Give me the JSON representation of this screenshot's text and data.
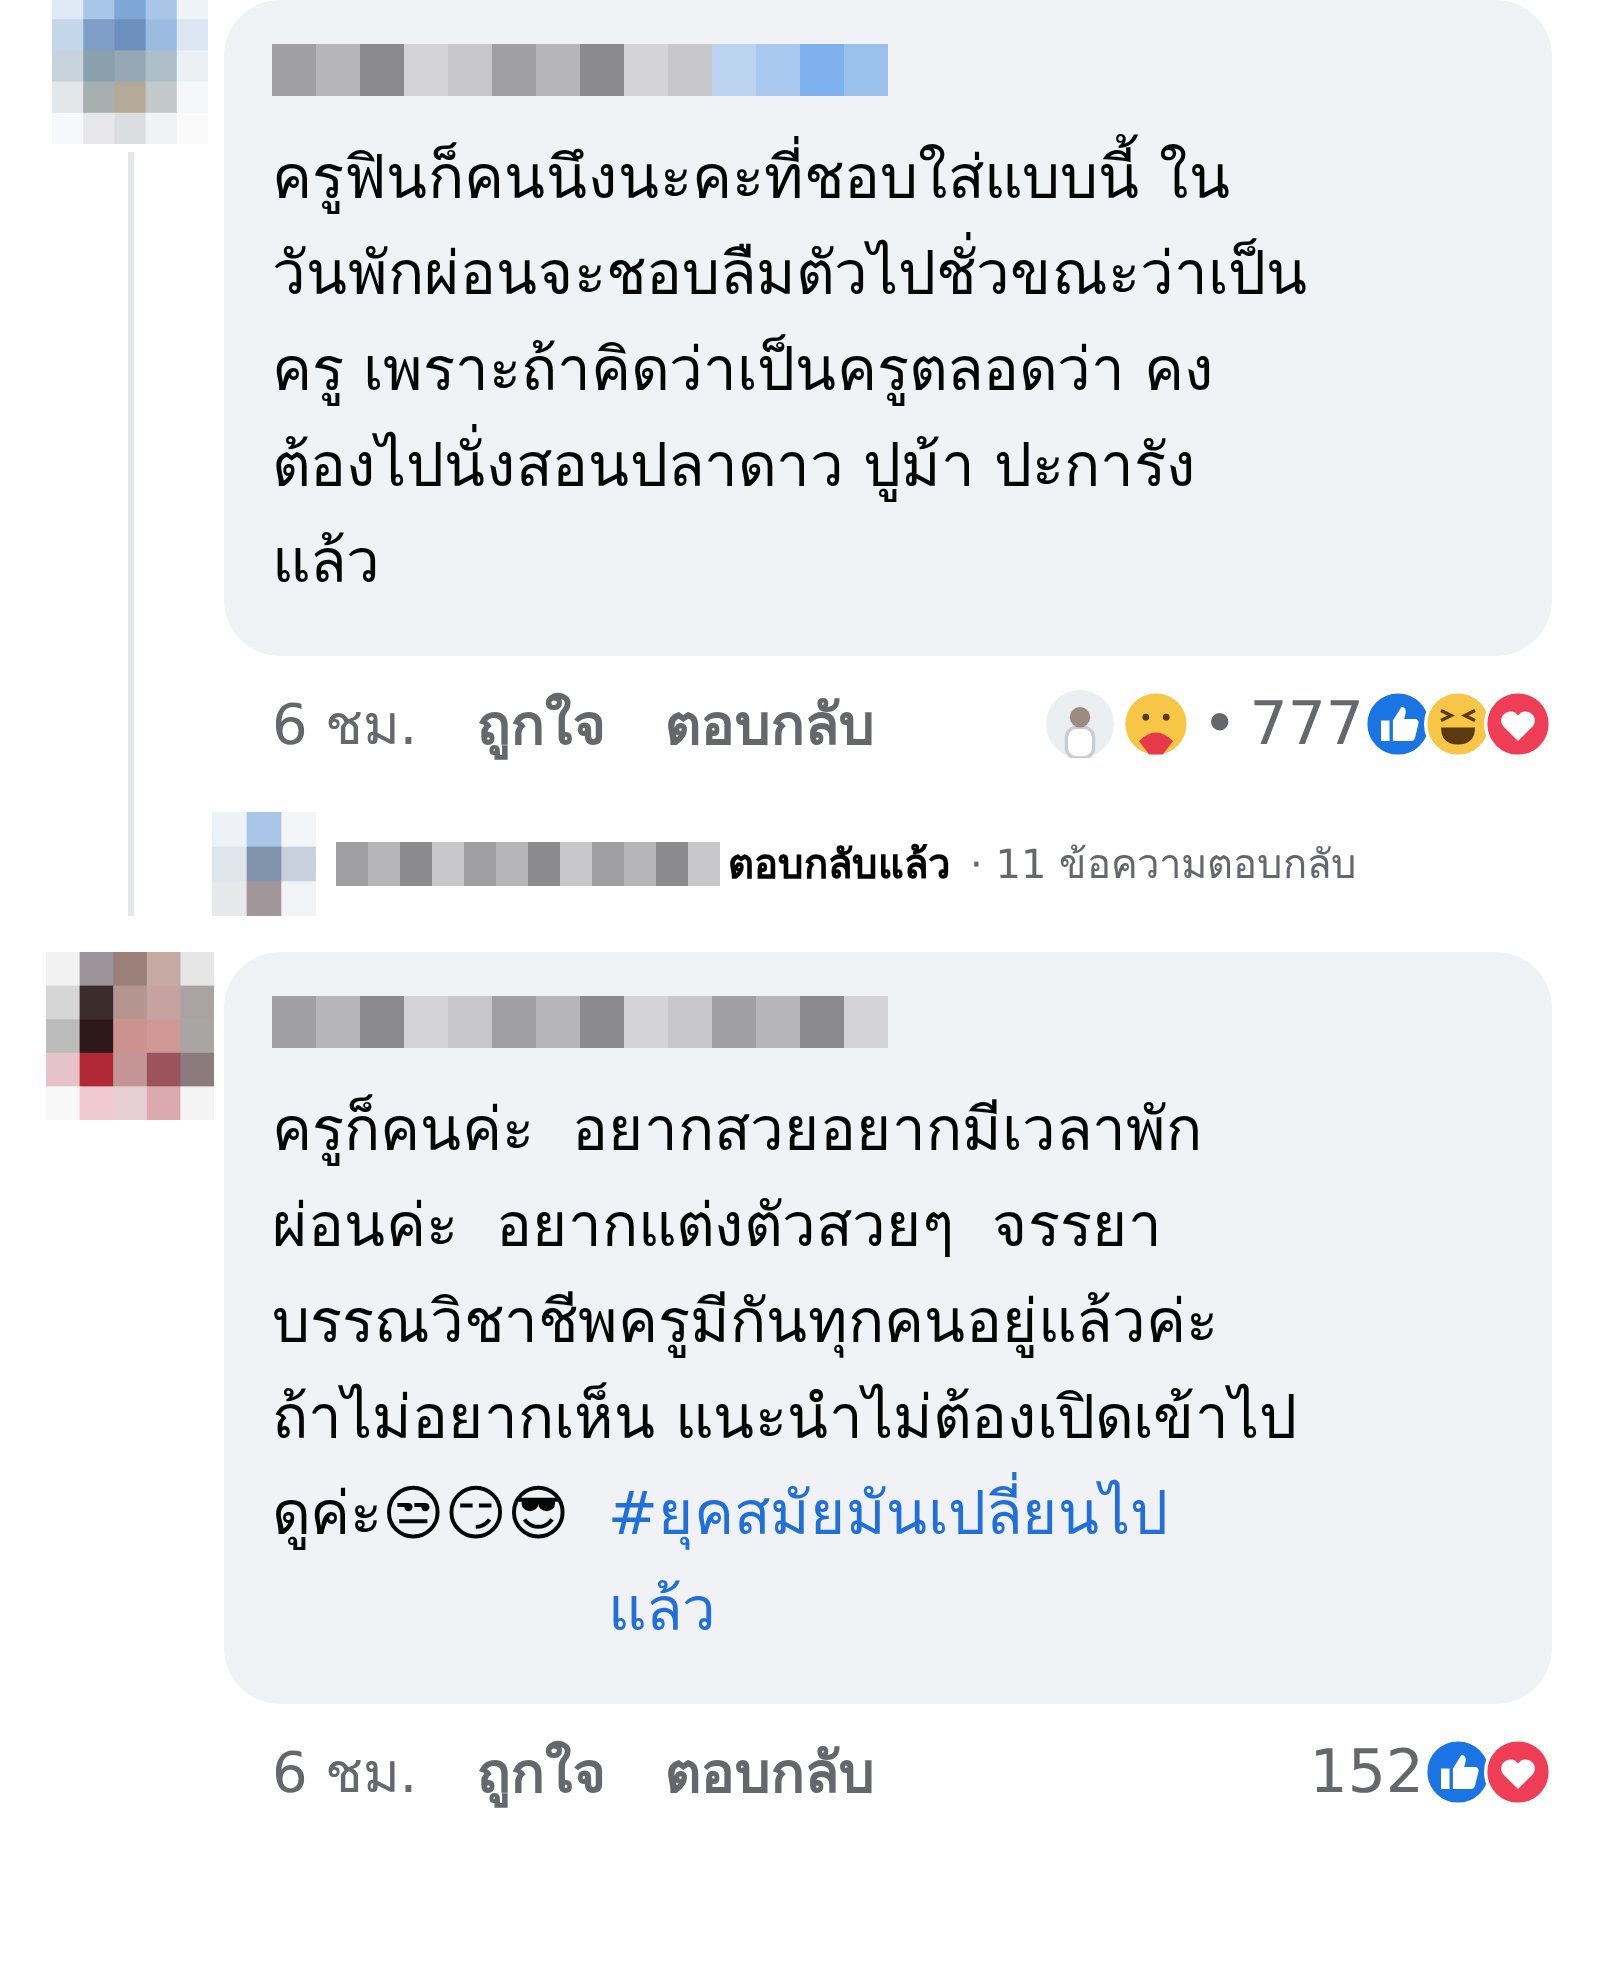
{
  "comments": [
    {
      "text": "ครูฟินก็คนนึงนะคะที่ชอบใส่แบบนี้ ใน\nวันพักผ่อนจะชอบลืมตัวไปชั่วขณะว่าเป็น\nครู เพราะถ้าคิดว่าเป็นครูตลอดว่า คง\nต้องไปนั่งสอนปลาดาว ปูม้า ปะการัง\nแล้ว",
      "time": "6 ชม.",
      "like": "ถูกใจ",
      "reply": "ตอบกลับ",
      "reacted_by": [
        {
          "kind": "photo"
        },
        {
          "kind": "care"
        }
      ],
      "separator": "•",
      "count": "777",
      "reactions": [
        {
          "kind": "like"
        },
        {
          "kind": "haha"
        },
        {
          "kind": "love"
        }
      ],
      "replies_summary": {
        "replied": "ตอบกลับแล้ว",
        "count": "· 11 ข้อความตอบกลับ"
      }
    },
    {
      "text": "ครูก็คนค่ะ  อยากสวยอยากมีเวลาพัก\nผ่อนค่ะ  อยากแต่งตัวสวยๆ  จรรยา\nบรรณวิชาชีพครูมีกันทุกคนอยู่แล้วค่ะ\nถ้าไม่อยากเห็น แนะนำไม่ต้องเปิดเข้าไป\nดูค่ะ😒😏😎  ",
      "hashtag": "#ยุคสมัยมันเปลี่ยนไป\nแล้ว",
      "time": "6 ชม.",
      "like": "ถูกใจ",
      "reply": "ตอบกลับ",
      "count": "152",
      "reactions": [
        {
          "kind": "like"
        },
        {
          "kind": "love"
        }
      ]
    }
  ]
}
